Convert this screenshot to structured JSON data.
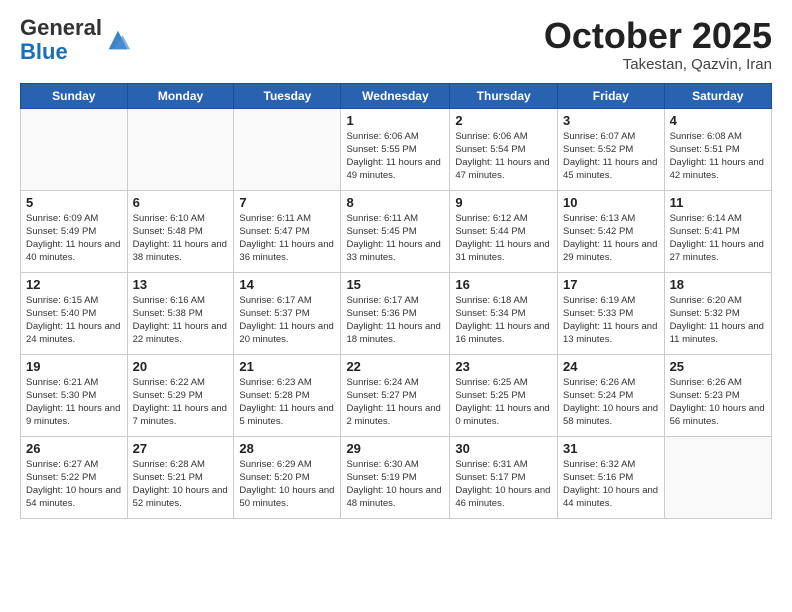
{
  "header": {
    "logo_general": "General",
    "logo_blue": "Blue",
    "month": "October 2025",
    "location": "Takestan, Qazvin, Iran"
  },
  "days_of_week": [
    "Sunday",
    "Monday",
    "Tuesday",
    "Wednesday",
    "Thursday",
    "Friday",
    "Saturday"
  ],
  "weeks": [
    [
      {
        "day": "",
        "info": ""
      },
      {
        "day": "",
        "info": ""
      },
      {
        "day": "",
        "info": ""
      },
      {
        "day": "1",
        "info": "Sunrise: 6:06 AM\nSunset: 5:55 PM\nDaylight: 11 hours and 49 minutes."
      },
      {
        "day": "2",
        "info": "Sunrise: 6:06 AM\nSunset: 5:54 PM\nDaylight: 11 hours and 47 minutes."
      },
      {
        "day": "3",
        "info": "Sunrise: 6:07 AM\nSunset: 5:52 PM\nDaylight: 11 hours and 45 minutes."
      },
      {
        "day": "4",
        "info": "Sunrise: 6:08 AM\nSunset: 5:51 PM\nDaylight: 11 hours and 42 minutes."
      }
    ],
    [
      {
        "day": "5",
        "info": "Sunrise: 6:09 AM\nSunset: 5:49 PM\nDaylight: 11 hours and 40 minutes."
      },
      {
        "day": "6",
        "info": "Sunrise: 6:10 AM\nSunset: 5:48 PM\nDaylight: 11 hours and 38 minutes."
      },
      {
        "day": "7",
        "info": "Sunrise: 6:11 AM\nSunset: 5:47 PM\nDaylight: 11 hours and 36 minutes."
      },
      {
        "day": "8",
        "info": "Sunrise: 6:11 AM\nSunset: 5:45 PM\nDaylight: 11 hours and 33 minutes."
      },
      {
        "day": "9",
        "info": "Sunrise: 6:12 AM\nSunset: 5:44 PM\nDaylight: 11 hours and 31 minutes."
      },
      {
        "day": "10",
        "info": "Sunrise: 6:13 AM\nSunset: 5:42 PM\nDaylight: 11 hours and 29 minutes."
      },
      {
        "day": "11",
        "info": "Sunrise: 6:14 AM\nSunset: 5:41 PM\nDaylight: 11 hours and 27 minutes."
      }
    ],
    [
      {
        "day": "12",
        "info": "Sunrise: 6:15 AM\nSunset: 5:40 PM\nDaylight: 11 hours and 24 minutes."
      },
      {
        "day": "13",
        "info": "Sunrise: 6:16 AM\nSunset: 5:38 PM\nDaylight: 11 hours and 22 minutes."
      },
      {
        "day": "14",
        "info": "Sunrise: 6:17 AM\nSunset: 5:37 PM\nDaylight: 11 hours and 20 minutes."
      },
      {
        "day": "15",
        "info": "Sunrise: 6:17 AM\nSunset: 5:36 PM\nDaylight: 11 hours and 18 minutes."
      },
      {
        "day": "16",
        "info": "Sunrise: 6:18 AM\nSunset: 5:34 PM\nDaylight: 11 hours and 16 minutes."
      },
      {
        "day": "17",
        "info": "Sunrise: 6:19 AM\nSunset: 5:33 PM\nDaylight: 11 hours and 13 minutes."
      },
      {
        "day": "18",
        "info": "Sunrise: 6:20 AM\nSunset: 5:32 PM\nDaylight: 11 hours and 11 minutes."
      }
    ],
    [
      {
        "day": "19",
        "info": "Sunrise: 6:21 AM\nSunset: 5:30 PM\nDaylight: 11 hours and 9 minutes."
      },
      {
        "day": "20",
        "info": "Sunrise: 6:22 AM\nSunset: 5:29 PM\nDaylight: 11 hours and 7 minutes."
      },
      {
        "day": "21",
        "info": "Sunrise: 6:23 AM\nSunset: 5:28 PM\nDaylight: 11 hours and 5 minutes."
      },
      {
        "day": "22",
        "info": "Sunrise: 6:24 AM\nSunset: 5:27 PM\nDaylight: 11 hours and 2 minutes."
      },
      {
        "day": "23",
        "info": "Sunrise: 6:25 AM\nSunset: 5:25 PM\nDaylight: 11 hours and 0 minutes."
      },
      {
        "day": "24",
        "info": "Sunrise: 6:26 AM\nSunset: 5:24 PM\nDaylight: 10 hours and 58 minutes."
      },
      {
        "day": "25",
        "info": "Sunrise: 6:26 AM\nSunset: 5:23 PM\nDaylight: 10 hours and 56 minutes."
      }
    ],
    [
      {
        "day": "26",
        "info": "Sunrise: 6:27 AM\nSunset: 5:22 PM\nDaylight: 10 hours and 54 minutes."
      },
      {
        "day": "27",
        "info": "Sunrise: 6:28 AM\nSunset: 5:21 PM\nDaylight: 10 hours and 52 minutes."
      },
      {
        "day": "28",
        "info": "Sunrise: 6:29 AM\nSunset: 5:20 PM\nDaylight: 10 hours and 50 minutes."
      },
      {
        "day": "29",
        "info": "Sunrise: 6:30 AM\nSunset: 5:19 PM\nDaylight: 10 hours and 48 minutes."
      },
      {
        "day": "30",
        "info": "Sunrise: 6:31 AM\nSunset: 5:17 PM\nDaylight: 10 hours and 46 minutes."
      },
      {
        "day": "31",
        "info": "Sunrise: 6:32 AM\nSunset: 5:16 PM\nDaylight: 10 hours and 44 minutes."
      },
      {
        "day": "",
        "info": ""
      }
    ]
  ]
}
